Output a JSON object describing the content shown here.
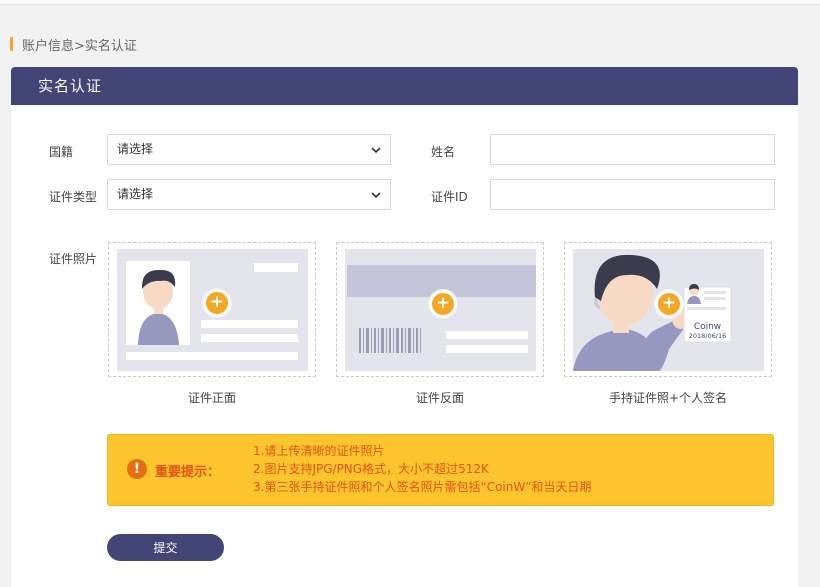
{
  "breadcrumb": "账户信息>实名认证",
  "card": {
    "title": "实名认证"
  },
  "form": {
    "nationality_label": "国籍",
    "nationality_value": "请选择",
    "id_type_label": "证件类型",
    "id_type_value": "请选择",
    "name_label": "姓名",
    "name_value": "",
    "id_label": "证件ID",
    "id_value": "",
    "photos_label": "证件照片"
  },
  "uploads": [
    {
      "caption": "证件正面",
      "icon": "plus-icon"
    },
    {
      "caption": "证件反面",
      "icon": "plus-icon"
    },
    {
      "caption": "手持证件照+个人签名",
      "icon": "plus-icon",
      "card_text": "Coinw",
      "card_date": "2018/06/16"
    }
  ],
  "notice": {
    "title": "重要提示：",
    "lines": [
      "1.请上传清晰的证件照片",
      "2.图片支持JPG/PNG格式，大小不超过512K",
      "3.第三张手持证件照和个人签名照片需包括“CoinW”和当天日期"
    ],
    "icon": "exclamation-icon"
  },
  "submit_label": "提交",
  "colors": {
    "header": "#434576",
    "accent": "#f5a623",
    "notice_bg": "#fdc52d",
    "notice_text": "#e0541b"
  }
}
